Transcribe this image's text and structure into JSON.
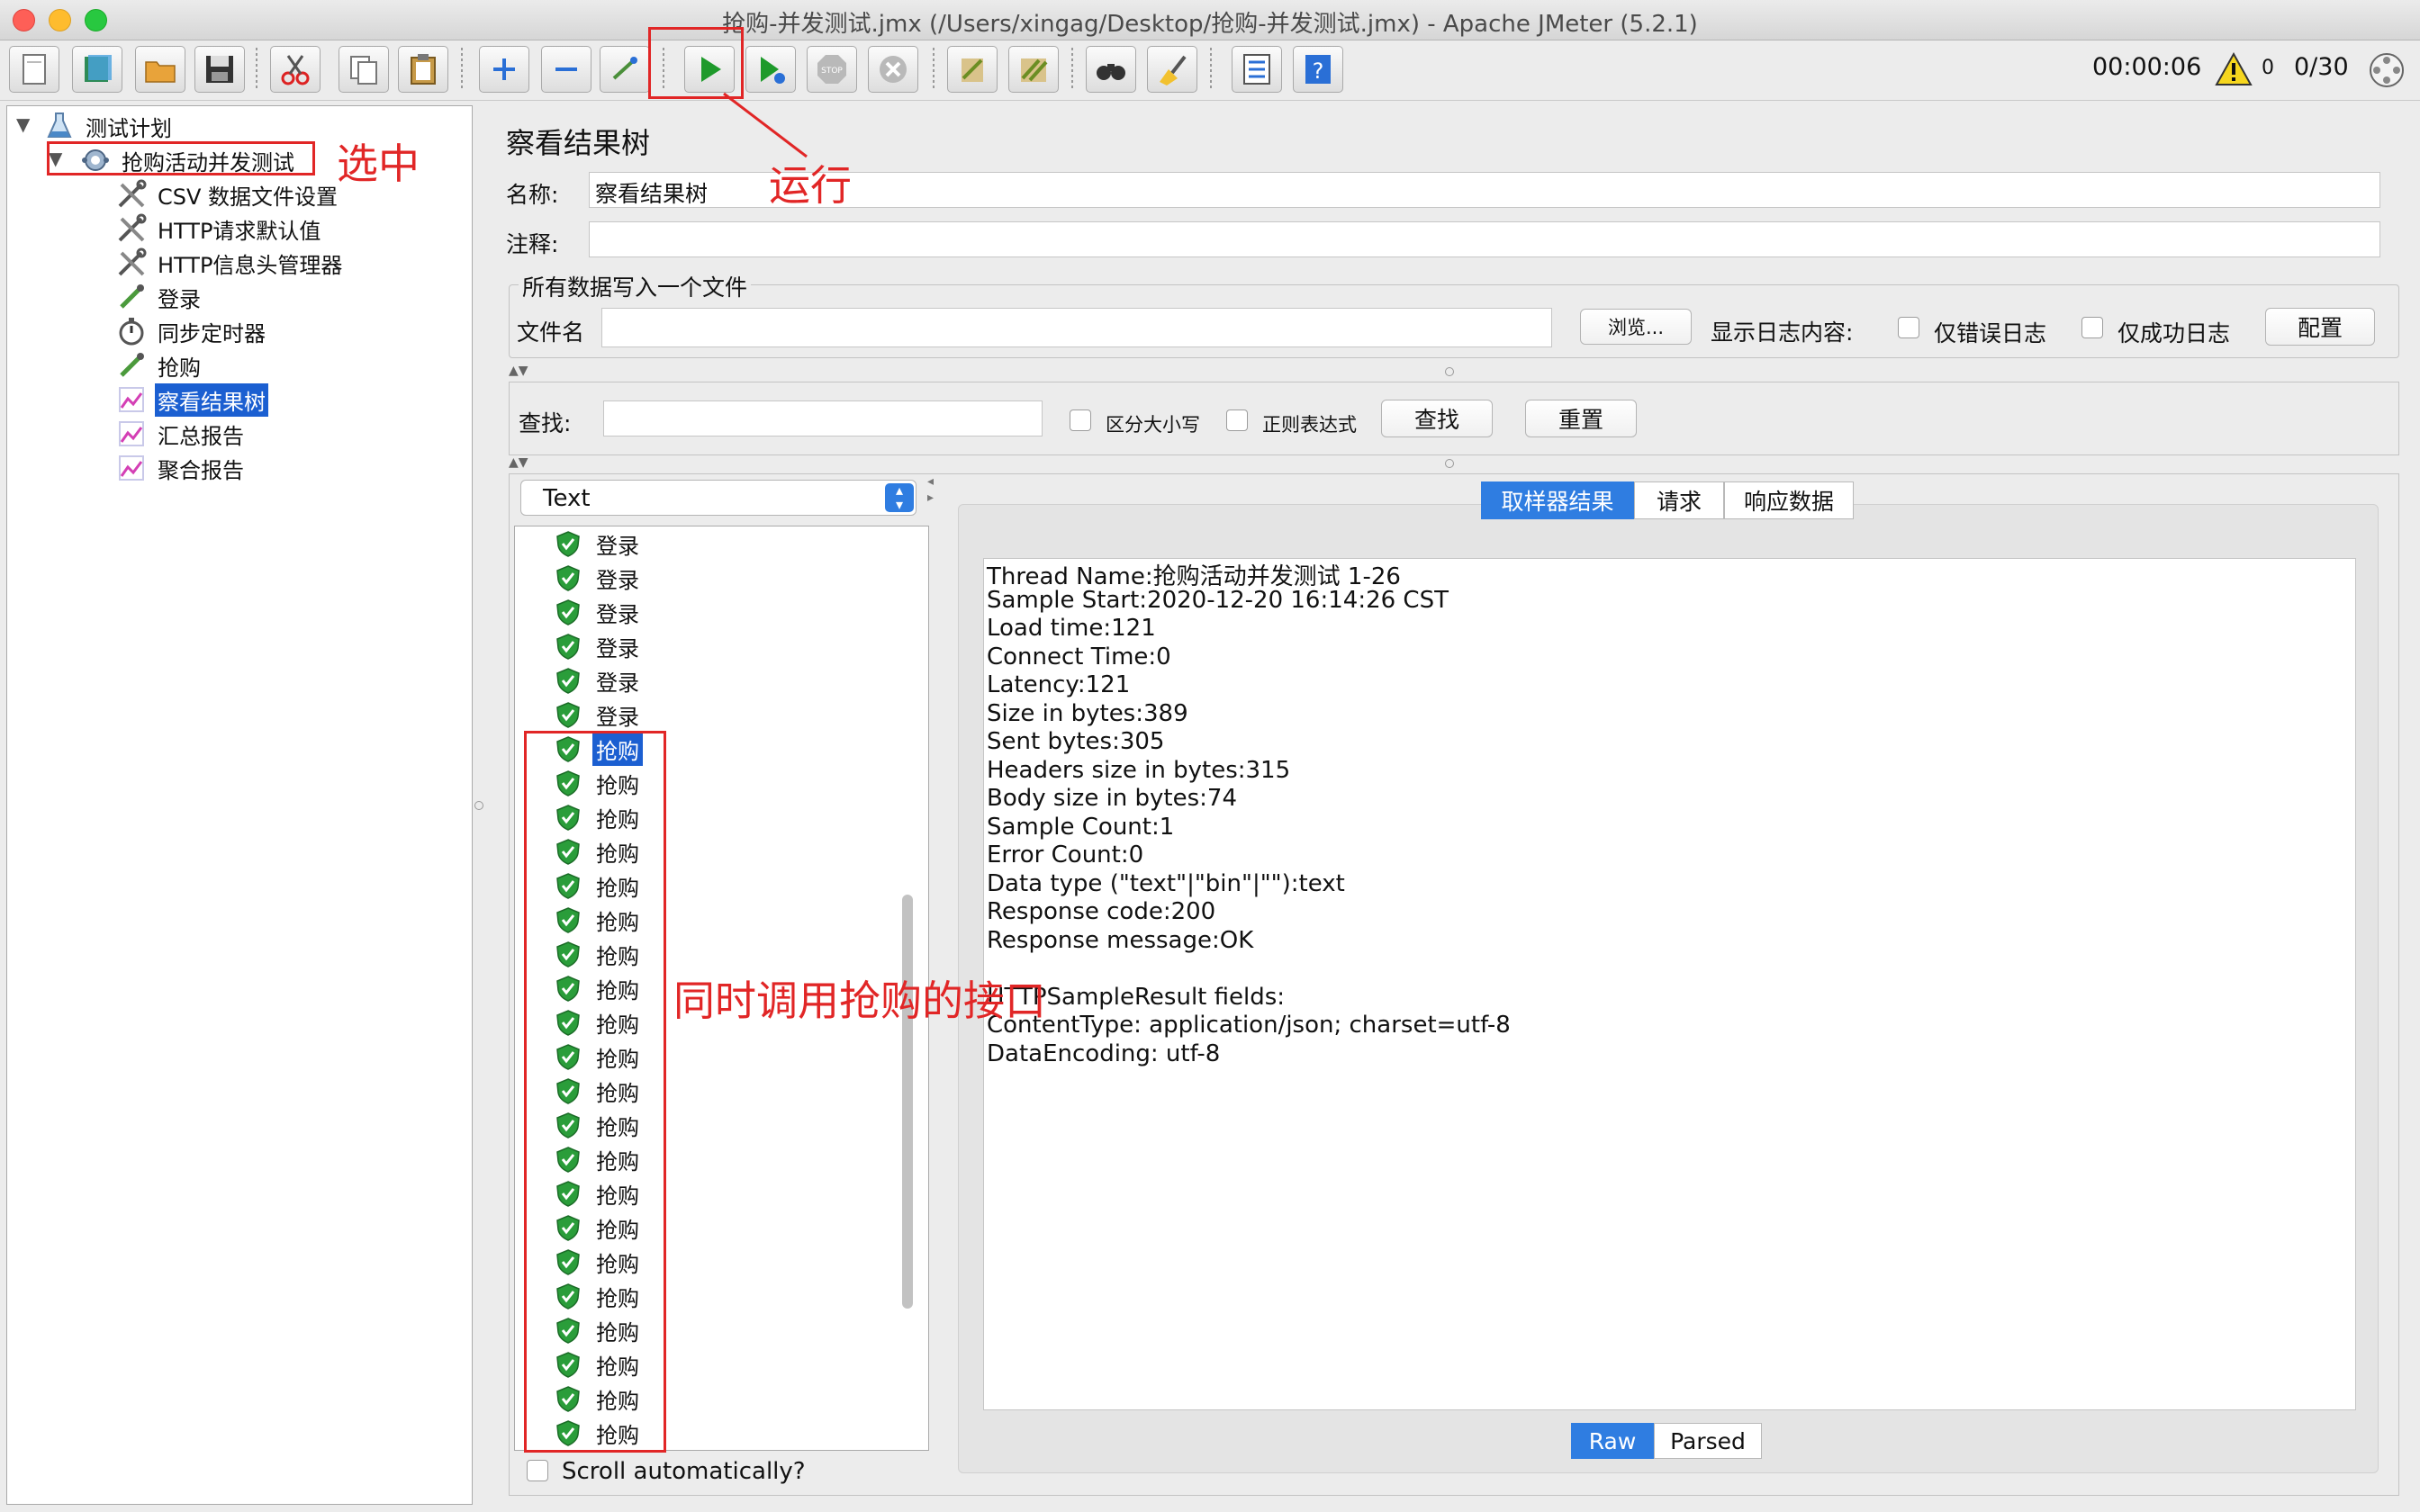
{
  "window": {
    "title": "抢购-并发测试.jmx (/Users/xingag/Desktop/抢购-并发测试.jmx) - Apache JMeter (5.2.1)"
  },
  "toolbar": {
    "timer": "00:00:06",
    "warning_count": "0",
    "threads": "0/30"
  },
  "tree": {
    "items": [
      {
        "label": "测试计划",
        "icon": "test-plan-icon"
      },
      {
        "label": "抢购活动并发测试",
        "icon": "thread-group-icon"
      },
      {
        "label": "CSV 数据文件设置",
        "icon": "wrench-icon"
      },
      {
        "label": "HTTP请求默认值",
        "icon": "wrench-icon"
      },
      {
        "label": "HTTP信息头管理器",
        "icon": "wrench-icon"
      },
      {
        "label": "登录",
        "icon": "sampler-icon"
      },
      {
        "label": "同步定时器",
        "icon": "timer-icon"
      },
      {
        "label": "抢购",
        "icon": "sampler-icon"
      },
      {
        "label": "察看结果树",
        "icon": "listener-icon"
      },
      {
        "label": "汇总报告",
        "icon": "listener-icon"
      },
      {
        "label": "聚合报告",
        "icon": "listener-icon"
      }
    ]
  },
  "panel": {
    "title": "察看结果树",
    "name_label": "名称:",
    "name_value": "察看结果树",
    "comment_label": "注释:",
    "comment_value": "",
    "file_group_title": "所有数据写入一个文件",
    "filename_label": "文件名",
    "filename_value": "",
    "browse_button": "浏览...",
    "log_label": "显示日志内容:",
    "errors_only": "仅错误日志",
    "success_only": "仅成功日志",
    "configure_button": "配置",
    "search_label": "查找:",
    "search_value": "",
    "case_sensitive": "区分大小写",
    "regex": "正则表达式",
    "find_button": "查找",
    "reset_button": "重置",
    "renderer": "Text",
    "scroll_auto": "Scroll automatically?"
  },
  "results": {
    "items": [
      "登录",
      "登录",
      "登录",
      "登录",
      "登录",
      "登录",
      "抢购",
      "抢购",
      "抢购",
      "抢购",
      "抢购",
      "抢购",
      "抢购",
      "抢购",
      "抢购",
      "抢购",
      "抢购",
      "抢购",
      "抢购",
      "抢购",
      "抢购",
      "抢购",
      "抢购",
      "抢购",
      "抢购",
      "抢购",
      "抢购"
    ],
    "selected_index": 6
  },
  "tabs": [
    "取样器结果",
    "请求",
    "响应数据"
  ],
  "detail": {
    "lines": [
      "Thread Name:抢购活动并发测试 1-26",
      "Sample Start:2020-12-20 16:14:26 CST",
      "Load time:121",
      "Connect Time:0",
      "Latency:121",
      "Size in bytes:389",
      "Sent bytes:305",
      "Headers size in bytes:315",
      "Body size in bytes:74",
      "Sample Count:1",
      "Error Count:0",
      "Data type (\"text\"|\"bin\"|\"\"):text",
      "Response code:200",
      "Response message:OK",
      "",
      "HTTPSampleResult fields:",
      "ContentType: application/json; charset=utf-8",
      "DataEncoding: utf-8"
    ]
  },
  "view_toggle": [
    "Raw",
    "Parsed"
  ],
  "annotations": {
    "selected": "选中",
    "run": "运行",
    "concurrent": "同时调用抢购的接口"
  },
  "colors": {
    "accent": "#2f7de1",
    "selection": "#1b5fd1",
    "annotation": "#e12626",
    "success_shield": "#2a9d3a"
  }
}
